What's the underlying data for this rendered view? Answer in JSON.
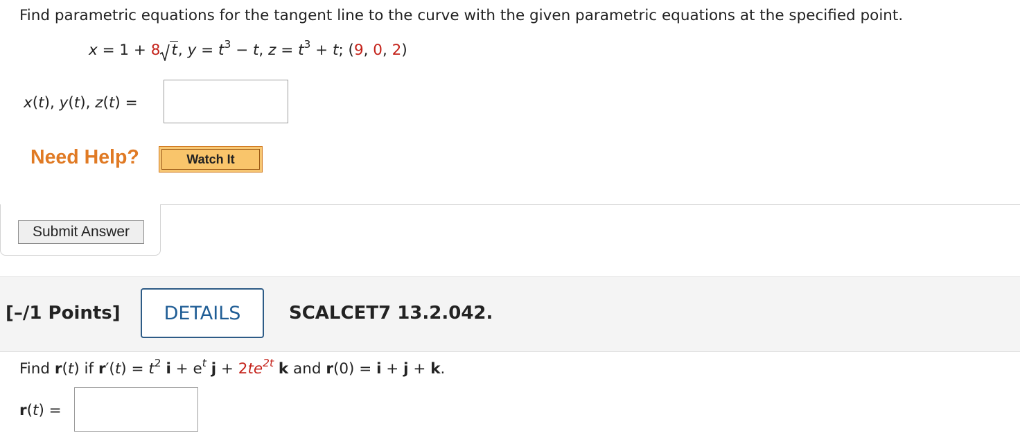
{
  "question1": {
    "prompt": "Find parametric equations for the tangent line to the curve with the given parametric equations at the specified point.",
    "equation": {
      "x_lhs": "x = 1 + ",
      "x_coef": "8",
      "x_radicand": "t",
      "y_part": ", y = t",
      "y_exp": "3",
      "y_rest": " − t, z = t",
      "z_exp": "3",
      "z_rest": " + t; ",
      "point_open": "(",
      "point_x": "9",
      "point_sep1": ", ",
      "point_y": "0",
      "point_sep2": ", ",
      "point_z": "2",
      "point_close": ")"
    },
    "answer_label": "x(t), y(t), z(t)",
    "answer_equals": " = ",
    "answer_value": ""
  },
  "help": {
    "need_help": "Need Help?",
    "watch_it": "Watch It"
  },
  "submit": {
    "label": "Submit Answer"
  },
  "question2": {
    "points": "[–/1 Points]",
    "details": "DETAILS",
    "problem_id": "SCALCET7 13.2.042.",
    "prompt": {
      "p1": "Find ",
      "r": "r",
      "p2": "(t) if ",
      "rprime": "r",
      "p3": "′(t) = ",
      "t2": "t",
      "t2_exp": "2",
      "i": "i",
      "p4": " + e",
      "e_exp": "t",
      "j": "j",
      "p5": " + ",
      "coef": "2te",
      "coef_exp": "2t",
      "k": "k",
      "p6": " and ",
      "r0": "r",
      "p7": "(0) = ",
      "i2": "i",
      "plus1": " + ",
      "j2": "j",
      "plus2": " + ",
      "k2": "k",
      "end": "."
    },
    "answer_r": "r",
    "answer_t": "(t)",
    "answer_equals": " = ",
    "answer_value": ""
  }
}
